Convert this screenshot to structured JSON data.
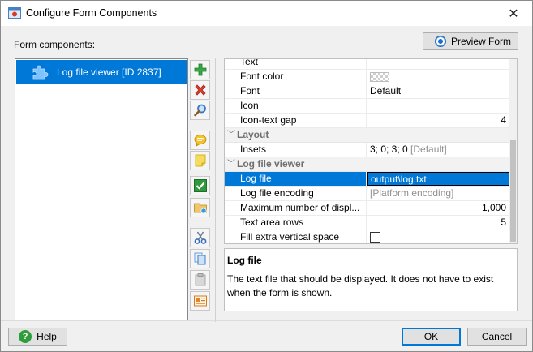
{
  "window": {
    "title": "Configure Form Components",
    "close_glyph": "✕"
  },
  "left": {
    "label": "Form components:",
    "tree_items": [
      {
        "label": "Log file viewer [ID 2837]",
        "icon": "puzzle-icon",
        "selected": true
      }
    ]
  },
  "preview_button": {
    "label": "Preview Form",
    "icon": "eye-icon"
  },
  "toolbar": [
    {
      "name": "add-component-button",
      "icon": "plus-icon",
      "color": "#2e9e3a"
    },
    {
      "name": "delete-component-button",
      "icon": "delete-x-icon",
      "color": "#d0362b"
    },
    {
      "name": "search-component-button",
      "icon": "magnifier-icon",
      "color": "#3a78c2"
    },
    {
      "name": "comment-button",
      "icon": "speech-bubble-icon",
      "color": "#e8b000"
    },
    {
      "name": "note-button",
      "icon": "sticky-note-icon",
      "color": "#f2d14a"
    },
    {
      "name": "check-button",
      "icon": "checkmark-icon",
      "color": "#2e9e3a"
    },
    {
      "name": "folder-button",
      "icon": "folder-icon",
      "color": "#e3b85a"
    },
    {
      "name": "cut-button",
      "icon": "scissors-icon",
      "color": "#2f6fbf"
    },
    {
      "name": "copy-button",
      "icon": "copy-icon",
      "color": "#6aa0d8"
    },
    {
      "name": "paste-button",
      "icon": "paste-icon",
      "color": "#bdbdbd"
    },
    {
      "name": "image-button",
      "icon": "picture-icon",
      "color": "#e0862d"
    }
  ],
  "properties": {
    "rows": [
      {
        "type": "prop",
        "name": "Text",
        "value": ""
      },
      {
        "type": "prop",
        "name": "Font color",
        "value": "",
        "swatch": true
      },
      {
        "type": "prop",
        "name": "Font",
        "value": "Default"
      },
      {
        "type": "prop",
        "name": "Icon",
        "value": ""
      },
      {
        "type": "prop",
        "name": "Icon-text gap",
        "value": "4",
        "align": "right"
      },
      {
        "type": "cat",
        "name": "Layout"
      },
      {
        "type": "prop",
        "name": "Insets",
        "value": "3; 0; 3; 0",
        "default_suffix": "[Default]"
      },
      {
        "type": "cat",
        "name": "Log file viewer"
      },
      {
        "type": "prop",
        "name": "Log file",
        "value": "output\\log.txt",
        "selected": true
      },
      {
        "type": "prop",
        "name": "Log file encoding",
        "value": "[Platform encoding]",
        "gray": true
      },
      {
        "type": "prop",
        "name": "Maximum number of displ...",
        "value": "1,000",
        "align": "right"
      },
      {
        "type": "prop",
        "name": "Text area rows",
        "value": "5",
        "align": "right"
      },
      {
        "type": "prop",
        "name": "Fill extra vertical space",
        "value": "",
        "checkbox": true
      }
    ]
  },
  "description": {
    "title": "Log file",
    "body": "The text file that should be displayed. It does not have to exist when the form is shown."
  },
  "footer": {
    "help_label": "Help",
    "ok_label": "OK",
    "cancel_label": "Cancel"
  }
}
